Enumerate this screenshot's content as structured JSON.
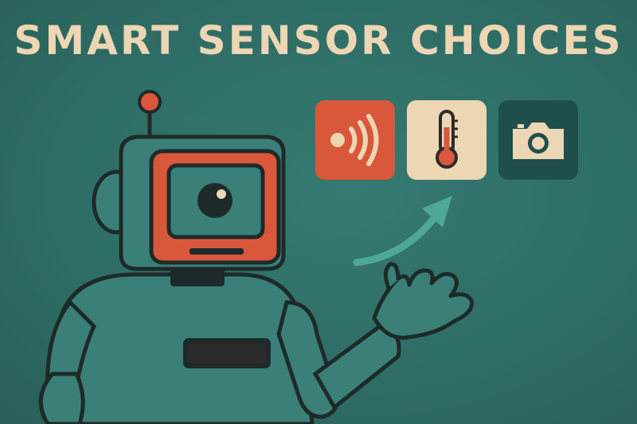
{
  "title": "SMART SENSOR CHOICES",
  "colors": {
    "background": "#2f6f68",
    "title": "#ecd6b3",
    "accent_orange": "#d9573a",
    "cream": "#ecd6b3",
    "dark_teal": "#1f4f4c",
    "robot_body": "#3b8078",
    "outline": "#1e2a2a"
  },
  "sensor_options": [
    {
      "name": "sound-sensor",
      "icon": "sound-waves-icon"
    },
    {
      "name": "temperature-sensor",
      "icon": "thermometer-icon"
    },
    {
      "name": "camera-sensor",
      "icon": "camera-icon"
    }
  ]
}
